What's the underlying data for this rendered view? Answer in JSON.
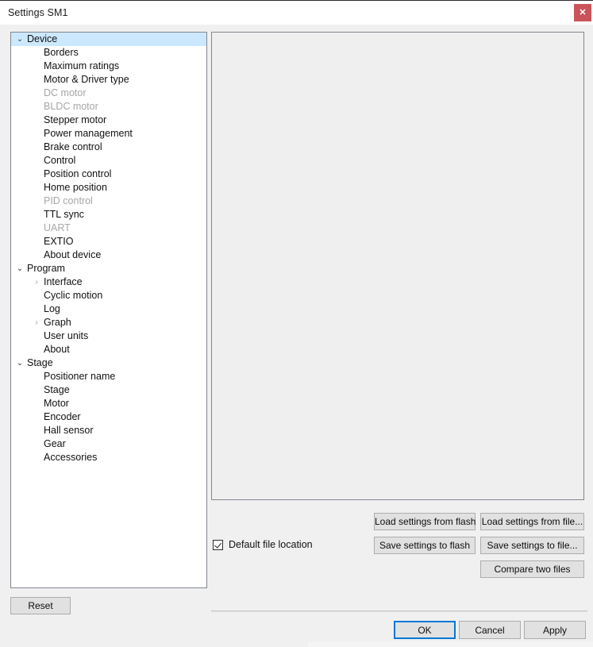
{
  "window": {
    "title": "Settings SM1",
    "close_icon": "close-icon",
    "close_glyph": "✕",
    "close_color": "#c9555b"
  },
  "tree": {
    "selected_index": 0,
    "items": [
      {
        "label": "Device",
        "level": 0,
        "chevron": "expanded",
        "disabled": false,
        "selected": true
      },
      {
        "label": "Borders",
        "level": 1,
        "chevron": "none",
        "disabled": false,
        "selected": false
      },
      {
        "label": "Maximum ratings",
        "level": 1,
        "chevron": "none",
        "disabled": false,
        "selected": false
      },
      {
        "label": "Motor & Driver type",
        "level": 1,
        "chevron": "none",
        "disabled": false,
        "selected": false
      },
      {
        "label": "DC motor",
        "level": 1,
        "chevron": "none",
        "disabled": true,
        "selected": false
      },
      {
        "label": "BLDC motor",
        "level": 1,
        "chevron": "none",
        "disabled": true,
        "selected": false
      },
      {
        "label": "Stepper motor",
        "level": 1,
        "chevron": "none",
        "disabled": false,
        "selected": false
      },
      {
        "label": "Power management",
        "level": 1,
        "chevron": "none",
        "disabled": false,
        "selected": false
      },
      {
        "label": "Brake control",
        "level": 1,
        "chevron": "none",
        "disabled": false,
        "selected": false
      },
      {
        "label": "Control",
        "level": 1,
        "chevron": "none",
        "disabled": false,
        "selected": false
      },
      {
        "label": "Position control",
        "level": 1,
        "chevron": "none",
        "disabled": false,
        "selected": false
      },
      {
        "label": "Home position",
        "level": 1,
        "chevron": "none",
        "disabled": false,
        "selected": false
      },
      {
        "label": "PID control",
        "level": 1,
        "chevron": "none",
        "disabled": true,
        "selected": false
      },
      {
        "label": "TTL sync",
        "level": 1,
        "chevron": "none",
        "disabled": false,
        "selected": false
      },
      {
        "label": "UART",
        "level": 1,
        "chevron": "none",
        "disabled": true,
        "selected": false
      },
      {
        "label": "EXTIO",
        "level": 1,
        "chevron": "none",
        "disabled": false,
        "selected": false
      },
      {
        "label": "About device",
        "level": 1,
        "chevron": "none",
        "disabled": false,
        "selected": false
      },
      {
        "label": "Program",
        "level": 0,
        "chevron": "expanded",
        "disabled": false,
        "selected": false
      },
      {
        "label": "Interface",
        "level": 1,
        "chevron": "collapsed",
        "disabled": false,
        "selected": false
      },
      {
        "label": "Cyclic motion",
        "level": 1,
        "chevron": "none",
        "disabled": false,
        "selected": false
      },
      {
        "label": "Log",
        "level": 1,
        "chevron": "none",
        "disabled": false,
        "selected": false
      },
      {
        "label": "Graph",
        "level": 1,
        "chevron": "collapsed",
        "disabled": false,
        "selected": false
      },
      {
        "label": "User units",
        "level": 1,
        "chevron": "none",
        "disabled": false,
        "selected": false
      },
      {
        "label": "About",
        "level": 1,
        "chevron": "none",
        "disabled": false,
        "selected": false
      },
      {
        "label": "Stage",
        "level": 0,
        "chevron": "expanded",
        "disabled": false,
        "selected": false
      },
      {
        "label": "Positioner name",
        "level": 1,
        "chevron": "none",
        "disabled": false,
        "selected": false
      },
      {
        "label": "Stage",
        "level": 1,
        "chevron": "none",
        "disabled": false,
        "selected": false
      },
      {
        "label": "Motor",
        "level": 1,
        "chevron": "none",
        "disabled": false,
        "selected": false
      },
      {
        "label": "Encoder",
        "level": 1,
        "chevron": "none",
        "disabled": false,
        "selected": false
      },
      {
        "label": "Hall sensor",
        "level": 1,
        "chevron": "none",
        "disabled": false,
        "selected": false
      },
      {
        "label": "Gear",
        "level": 1,
        "chevron": "none",
        "disabled": false,
        "selected": false
      },
      {
        "label": "Accessories",
        "level": 1,
        "chevron": "none",
        "disabled": false,
        "selected": false
      }
    ],
    "chevron_expanded_glyph": "⌄",
    "chevron_collapsed_glyph": "›",
    "selection_color": "#cce8ff"
  },
  "reset": {
    "label": "Reset"
  },
  "file_ops": {
    "default_file_location_label": "Default file location",
    "default_file_location_checked": true,
    "load_from_flash": "Load settings from flash",
    "load_from_file": "Load settings from file...",
    "save_to_flash": "Save settings to flash",
    "save_to_file": "Save settings to file...",
    "compare_two_files": "Compare two files"
  },
  "dialog_buttons": {
    "ok": "OK",
    "cancel": "Cancel",
    "apply": "Apply",
    "focus_color": "#0078d7"
  }
}
